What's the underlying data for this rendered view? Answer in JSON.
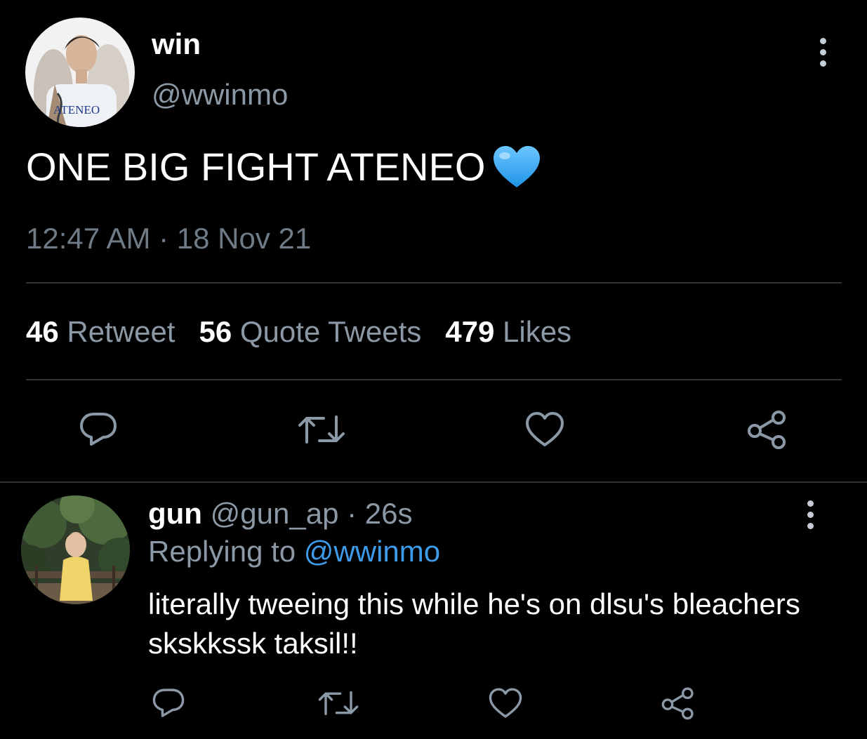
{
  "main_tweet": {
    "display_name": "win",
    "handle": "@wwinmo",
    "avatar_jersey_text": "ATENEO",
    "text": "ONE BIG FIGHT ATENEO",
    "emoji": "blue-heart",
    "timestamp": "12:47 AM · 18 Nov 21",
    "stats": [
      {
        "count": "46",
        "label": "Retweet"
      },
      {
        "count": "56",
        "label": "Quote Tweets"
      },
      {
        "count": "479",
        "label": "Likes"
      }
    ]
  },
  "reply": {
    "display_name": "gun",
    "handle_time": "@gun_ap · 26s",
    "replying_label": "Replying to",
    "replying_to": "@wwinmo",
    "text": "literally tweeing this while he's on dlsu's bleachers skskkssk taksil!!"
  },
  "icons": [
    "more-vertical-icon",
    "reply-icon",
    "retweet-icon",
    "like-icon",
    "share-icon"
  ],
  "colors": {
    "background": "#000000",
    "primary_text": "#ffffff",
    "secondary_text": "#8b98a5",
    "link": "#3d9be9",
    "divider": "#2f3336",
    "heart_emoji": "#43b4f5"
  }
}
